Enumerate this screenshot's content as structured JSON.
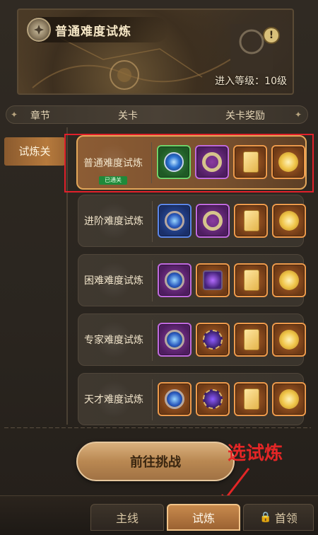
{
  "banner": {
    "title": "普通难度试炼",
    "level_requirement": "进入等级：10级",
    "notice_symbol": "!"
  },
  "columns": {
    "chapter": "章节",
    "stage": "关卡",
    "reward": "关卡奖励"
  },
  "chapter_tab": {
    "label": "试炼关"
  },
  "stages": [
    {
      "name": "普通难度试炼",
      "cleared_label": "已通关",
      "active": true,
      "rewards": [
        "green-gem-ring",
        "purple-ring",
        "orange-ticket",
        "orange-coin"
      ]
    },
    {
      "name": "进阶难度试炼",
      "active": false,
      "rewards": [
        "blue-amulet",
        "purple-ring",
        "orange-ticket",
        "orange-coin"
      ]
    },
    {
      "name": "困难难度试炼",
      "active": false,
      "rewards": [
        "purple-amulet",
        "orange-chest",
        "orange-ticket",
        "orange-coin"
      ]
    },
    {
      "name": "专家难度试炼",
      "active": false,
      "rewards": [
        "purple-amulet",
        "orange-necklace",
        "orange-ticket",
        "orange-coin"
      ]
    },
    {
      "name": "天才难度试炼",
      "active": false,
      "rewards": [
        "orange-amulet",
        "orange-necklace",
        "orange-ticket",
        "orange-coin"
      ]
    }
  ],
  "cta": {
    "label": "前往挑战"
  },
  "annotation": {
    "hint": "选试炼",
    "color": "#e32626"
  },
  "bottom_tabs": [
    {
      "label": "主线"
    },
    {
      "label": "试炼",
      "active": true
    },
    {
      "label": "首领",
      "locked": true
    }
  ],
  "colors": {
    "accent": "#e3a75a",
    "highlight_box": "#e0202a",
    "cleared_badge": "#1f8a3a"
  }
}
